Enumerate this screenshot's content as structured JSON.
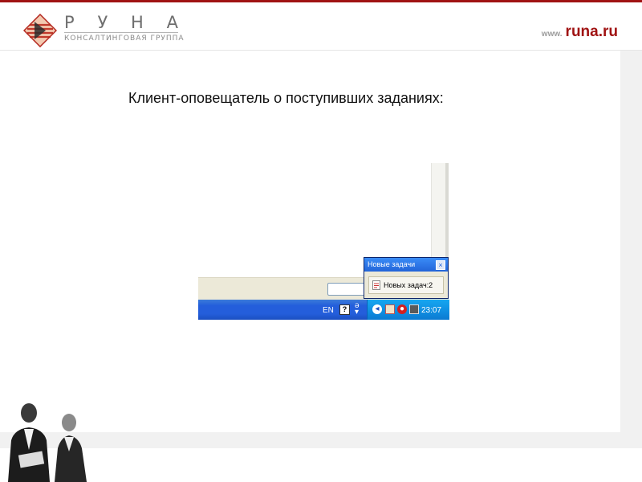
{
  "header": {
    "brand_letters": [
      "Р",
      "У",
      "Н",
      "А"
    ],
    "brand_sub": "КОНСАЛТИНГОВАЯ ГРУППА",
    "site_prefix": "www.",
    "site_domain": "runa.ru",
    "brand_color": "#a01313"
  },
  "slide": {
    "title": "Клиент-оповещатель о поступивших заданиях:"
  },
  "screenshot": {
    "taskbar": {
      "language": "EN",
      "help_label": "?",
      "tray_icons": [
        "back-icon",
        "notifier-icon",
        "antivirus-icon",
        "network-icon"
      ],
      "clock": "23:07"
    },
    "popup": {
      "title": "Новые задачи",
      "close_label": "×",
      "item_label": "Новых задач:2"
    }
  }
}
